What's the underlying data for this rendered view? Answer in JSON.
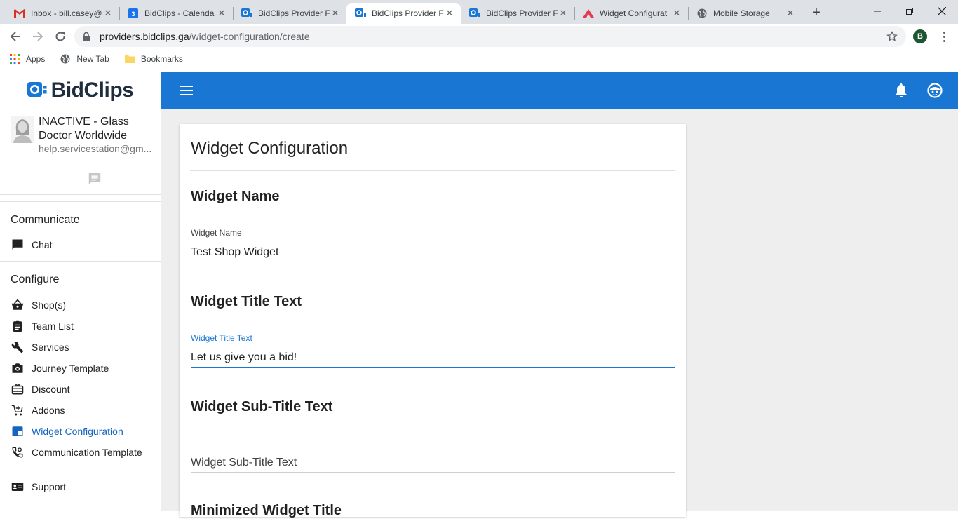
{
  "browser": {
    "tabs": [
      {
        "title": "Inbox - bill.casey@",
        "icon": "gmail-icon"
      },
      {
        "title": "BidClips - Calenda",
        "icon": "calendar-icon"
      },
      {
        "title": "BidClips Provider F",
        "icon": "bidclips-icon"
      },
      {
        "title": "BidClips Provider F",
        "icon": "bidclips-icon",
        "active": true
      },
      {
        "title": "BidClips Provider F",
        "icon": "bidclips-icon"
      },
      {
        "title": "Widget Configurat",
        "icon": "app-icon"
      },
      {
        "title": "Mobile Storage",
        "icon": "globe-icon"
      }
    ],
    "url_host": "providers.bidclips.ga",
    "url_path": "/widget-configuration/create",
    "profile_initial": "B",
    "bookmarks": [
      "Apps",
      "New Tab",
      "Bookmarks"
    ]
  },
  "app": {
    "logo_text": "BidClips",
    "brand_color": "#1976d2",
    "profile": {
      "name": "INACTIVE - Glass Doctor Worldwide",
      "email": "help.servicestation@gm..."
    },
    "sections": [
      {
        "title": "Communicate",
        "items": [
          {
            "label": "Chat",
            "icon": "chat-icon"
          }
        ]
      },
      {
        "title": "Configure",
        "items": [
          {
            "label": "Shop(s)",
            "icon": "basket-icon"
          },
          {
            "label": "Team List",
            "icon": "clipboard-icon"
          },
          {
            "label": "Services",
            "icon": "wrench-icon"
          },
          {
            "label": "Journey Template",
            "icon": "camera-icon"
          },
          {
            "label": "Discount",
            "icon": "gift-card-icon"
          },
          {
            "label": "Addons",
            "icon": "cart-plus-icon"
          },
          {
            "label": "Widget Configuration",
            "icon": "widget-icon",
            "active": true
          },
          {
            "label": "Communication Template",
            "icon": "phone-settings-icon"
          }
        ]
      },
      {
        "title": "",
        "items": [
          {
            "label": "Support",
            "icon": "contact-card-icon"
          }
        ]
      }
    ]
  },
  "form": {
    "title": "Widget Configuration",
    "widget_name": {
      "heading": "Widget Name",
      "label": "Widget Name",
      "value": "Test Shop Widget"
    },
    "widget_title": {
      "heading": "Widget Title Text",
      "label": "Widget Title Text",
      "value": "Let us give you a bid!"
    },
    "widget_subtitle": {
      "heading": "Widget Sub-Title Text",
      "placeholder": "Widget Sub-Title Text"
    },
    "minimized_title": {
      "heading": "Minimized Widget Title"
    }
  }
}
